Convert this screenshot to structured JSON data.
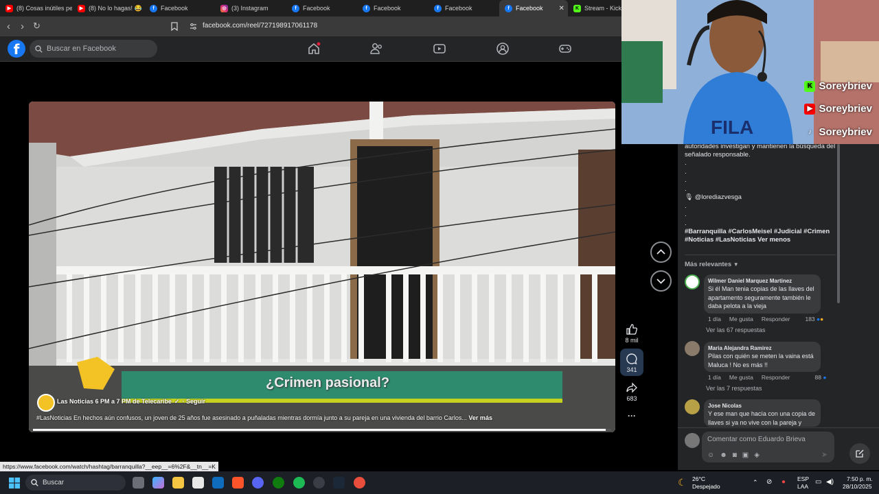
{
  "browser": {
    "tabs": [
      {
        "icon": "youtube-icon",
        "label": "(8) Cosas inútiles pe",
        "active": false
      },
      {
        "icon": "youtube-icon",
        "label": "(8) No lo hagas! 😂",
        "active": false
      },
      {
        "icon": "facebook-icon",
        "label": "Facebook",
        "active": false
      },
      {
        "icon": "instagram-icon",
        "label": "(3) Instagram",
        "active": false
      },
      {
        "icon": "facebook-icon",
        "label": "Facebook",
        "active": false
      },
      {
        "icon": "facebook-icon",
        "label": "Facebook",
        "active": false
      },
      {
        "icon": "facebook-icon",
        "label": "Facebook",
        "active": false
      },
      {
        "icon": "facebook-icon",
        "label": "Facebook",
        "active": true
      },
      {
        "icon": "kick-icon",
        "label": "Stream - Kick D",
        "active": false
      }
    ],
    "url": "facebook.com/reel/727198917061178",
    "status_link": "https://www.facebook.com/watch/hashtag/barranquilla?__eep__=6%2F&__tn__=K"
  },
  "fb": {
    "search_placeholder": "Buscar en Facebook",
    "logo_letter": "f"
  },
  "video": {
    "banner_text": "¿Crimen pasional?",
    "page_name": "Las Noticias 6 PM a 7 PM de Telecaribe",
    "verified": "✓",
    "follow": "· Seguir",
    "caption": "#LasNoticias En hechos aún confusos, un joven de 25 años fue asesinado a puñaladas mientras dormía junto a su pareja en una vivienda del barrio Carlos...",
    "see_more": "Ver más",
    "progress": 0.99
  },
  "actions": {
    "likes": "8 mil",
    "comments": "341",
    "shares": "683",
    "more": "···"
  },
  "panel": {
    "desc_lines": [
      "autoridades investigan y mantienen la búsqueda del",
      "señalado responsable."
    ],
    "dots": [
      ".",
      ".",
      ".",
      "."
    ],
    "mention": "🎙 @lorediazvesga",
    "dots2": [
      ".",
      ".",
      "."
    ],
    "hashtags_1": "#Barranquilla #CarlosMeisel #Judicial #Crimen",
    "hashtags_2": "#Noticias #LasNoticias",
    "see_less": "Ver menos",
    "sort_label": "Más relevantes",
    "comments": [
      {
        "name": "Wilmer Daniel Marquez Martinez",
        "text": "Si él Man tenia copias de las llaves del apartamento seguramente también le daba pelota a la vieja",
        "time": "1 día",
        "like": "Me gusta",
        "reply": "Responder",
        "reactions": "183",
        "replies": "Ver las 67 respuestas"
      },
      {
        "name": "Maria Alejandra Ramirez",
        "text": "Pilas con quién se meten la vaina está Maluca ! No es más !!",
        "time": "1 día",
        "like": "Me gusta",
        "reply": "Responder",
        "reactions": "88",
        "replies": "Ver las 7 respuestas"
      },
      {
        "name": "Jose Nicolas",
        "text": "Y ese man que hacía con una copia de llaves si ya no vive con la pareja y"
      }
    ],
    "comment_placeholder": "Comentar como Eduardo Brieva"
  },
  "webcam": {
    "socials": [
      {
        "icon": "kick-icon",
        "handle": "Soreybriev"
      },
      {
        "icon": "youtube-icon",
        "handle": "Soreybriev"
      },
      {
        "icon": "tiktok-icon",
        "handle": "Soreybriev"
      }
    ]
  },
  "taskbar": {
    "search_label": "Buscar",
    "weather_temp": "26°C",
    "weather_desc": "Despejado",
    "lang_1": "ESP",
    "lang_2": "LAA",
    "time": "7:50 p. m.",
    "date": "28/10/2025"
  }
}
